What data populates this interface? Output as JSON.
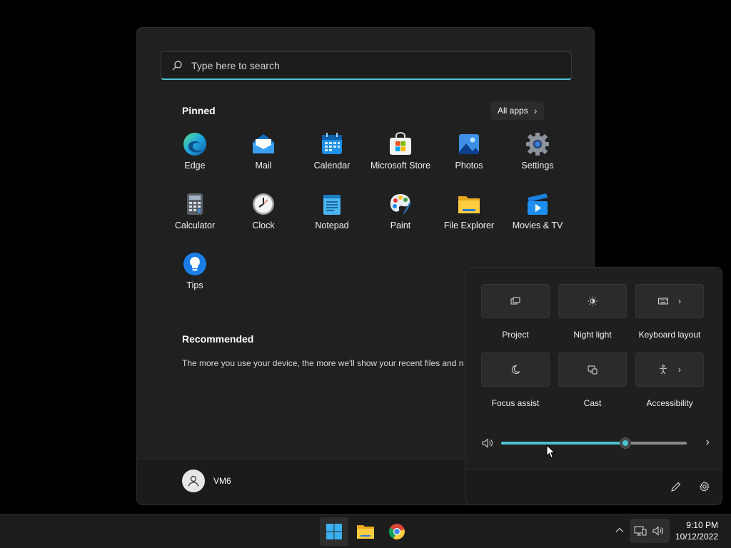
{
  "search": {
    "placeholder": "Type here to search"
  },
  "pinned": {
    "title": "Pinned",
    "all_apps_label": "All apps",
    "apps": [
      {
        "label": "Edge",
        "icon": "edge-icon"
      },
      {
        "label": "Mail",
        "icon": "mail-icon"
      },
      {
        "label": "Calendar",
        "icon": "calendar-icon"
      },
      {
        "label": "Microsoft Store",
        "icon": "store-icon"
      },
      {
        "label": "Photos",
        "icon": "photos-icon"
      },
      {
        "label": "Settings",
        "icon": "settings-icon"
      },
      {
        "label": "Calculator",
        "icon": "calculator-icon"
      },
      {
        "label": "Clock",
        "icon": "clock-icon"
      },
      {
        "label": "Notepad",
        "icon": "notepad-icon"
      },
      {
        "label": "Paint",
        "icon": "paint-icon"
      },
      {
        "label": "File Explorer",
        "icon": "folder-icon"
      },
      {
        "label": "Movies & TV",
        "icon": "movies-icon"
      },
      {
        "label": "Tips",
        "icon": "tips-icon"
      }
    ]
  },
  "recommended": {
    "title": "Recommended",
    "text": "The more you use your device, the more we'll show your recent files and n"
  },
  "user": {
    "name": "VM6"
  },
  "quick_settings": {
    "tiles": [
      {
        "label": "Project",
        "icon": "project-icon",
        "has_chevron": false
      },
      {
        "label": "Night light",
        "icon": "night-light-icon",
        "has_chevron": false
      },
      {
        "label": "Keyboard layout",
        "icon": "keyboard-icon",
        "has_chevron": true
      },
      {
        "label": "Focus assist",
        "icon": "moon-icon",
        "has_chevron": false
      },
      {
        "label": "Cast",
        "icon": "cast-icon",
        "has_chevron": false
      },
      {
        "label": "Accessibility",
        "icon": "accessibility-icon",
        "has_chevron": true
      }
    ],
    "volume_percent": 67
  },
  "taskbar": {
    "apps": [
      "start-icon",
      "file-explorer-icon",
      "chrome-icon"
    ],
    "time": "9:10 PM",
    "date": "10/12/2022"
  },
  "colors": {
    "accent": "#4cc2d1",
    "panel": "#202020",
    "taskbar": "#1c1c1c"
  }
}
